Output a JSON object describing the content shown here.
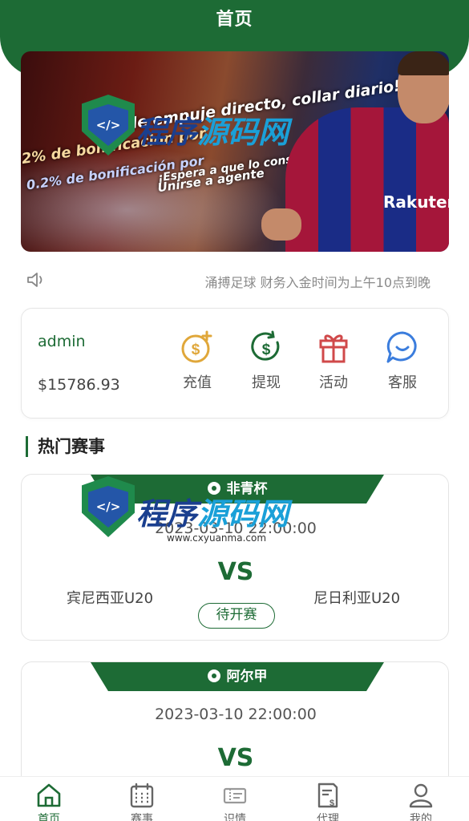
{
  "header": {
    "title": "首页"
  },
  "banner": {
    "lines": [
      "de empuje directo, collar diario!",
      "2% de bonificación por",
      "0.2% de bonificación por",
      "¡Espera a que lo consigas!",
      "Unirse a agente"
    ],
    "sponsor": "Rakuten"
  },
  "notice": {
    "text": "涌搏足球 财务入金时间为上午10点到晚"
  },
  "account": {
    "username": "admin",
    "balance": "$15786.93",
    "actions": [
      {
        "label": "充值",
        "icon": "coin-plus-icon",
        "color": "#e0a73a"
      },
      {
        "label": "提现",
        "icon": "cash-withdraw-icon",
        "color": "#1d6b35"
      },
      {
        "label": "活动",
        "icon": "gift-icon",
        "color": "#d0494a"
      },
      {
        "label": "客服",
        "icon": "chat-bubble-icon",
        "color": "#3b7ddd"
      }
    ]
  },
  "section": {
    "title": "热门赛事"
  },
  "matches": [
    {
      "league": "非青杯",
      "time": "2023-03-10 22:00:00",
      "vs": "VS",
      "home": "宾尼西亚U20",
      "away": "尼日利亚U20",
      "status": "待开赛"
    },
    {
      "league": "阿尔甲",
      "time": "2023-03-10 22:00:00",
      "vs": "VS"
    }
  ],
  "tabbar": [
    {
      "label": "首页",
      "icon": "home-icon",
      "active": true
    },
    {
      "label": "赛事",
      "icon": "calendar-icon",
      "active": false
    },
    {
      "label": "识情",
      "icon": "ticket-icon",
      "active": false
    },
    {
      "label": "代理",
      "icon": "document-dollar-icon",
      "active": false
    },
    {
      "label": "我的",
      "icon": "user-icon",
      "active": false
    }
  ],
  "watermark": {
    "text_part1": "程序",
    "text_part2": "源码网",
    "shield_text": "</>",
    "url": "www.cxyuanma.com"
  },
  "colors": {
    "primary": "#1d6b35",
    "muted": "#8a8a8a"
  }
}
